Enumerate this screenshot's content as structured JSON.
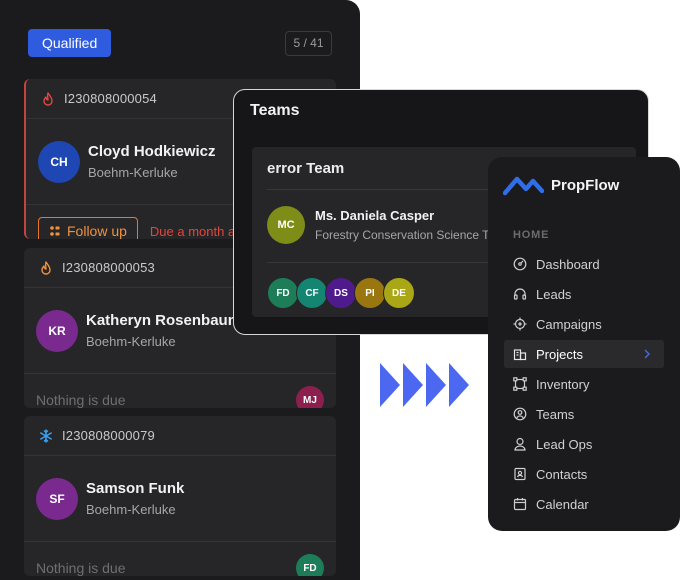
{
  "leads": {
    "status_label": "Qualified",
    "counter": "5 / 41",
    "cards": [
      {
        "id": "I230808000054",
        "priority_icon": "flame-outline-icon",
        "avatar": "CH",
        "avatar_color": "#1e47b3",
        "name": "Cloyd Hodkiewicz",
        "company": "Boehm-Kerluke",
        "action_label": "Follow up",
        "due_text": "Due a month ago"
      },
      {
        "id": "I230808000053",
        "priority_icon": "flame-icon",
        "avatar": "KR",
        "avatar_color": "#7a2a8f",
        "name": "Katheryn Rosenbaum",
        "company": "Boehm-Kerluke",
        "due_text": "Nothing is due",
        "assignee": "MJ",
        "assignee_color": "#8c1f4e"
      },
      {
        "id": "I230808000079",
        "priority_icon": "snowflake-icon",
        "avatar": "SF",
        "avatar_color": "#7a2a8f",
        "name": "Samson Funk",
        "company": "Boehm-Kerluke",
        "due_text": "Nothing is due",
        "assignee": "FD",
        "assignee_color": "#1d7d58"
      }
    ]
  },
  "teams": {
    "title": "Teams",
    "team_name": "error Team",
    "member": {
      "avatar": "MC",
      "avatar_color": "#7d8d17",
      "name": "Ms. Daniela Casper",
      "role": "Forestry Conservation Science Teacher"
    },
    "stack": [
      {
        "initials": "FD",
        "color": "#1d7d58"
      },
      {
        "initials": "CF",
        "color": "#148571"
      },
      {
        "initials": "DS",
        "color": "#4f1a8c"
      },
      {
        "initials": "PI",
        "color": "#9a7611"
      },
      {
        "initials": "DE",
        "color": "#a9a716"
      }
    ]
  },
  "nav": {
    "brand": "PropFlow",
    "section": "HOME",
    "items": [
      {
        "label": "Dashboard",
        "icon": "gauge-icon"
      },
      {
        "label": "Leads",
        "icon": "headset-icon"
      },
      {
        "label": "Campaigns",
        "icon": "target-icon"
      },
      {
        "label": "Projects",
        "icon": "building-icon",
        "active": true
      },
      {
        "label": "Inventory",
        "icon": "box-frame-icon"
      },
      {
        "label": "Teams",
        "icon": "users-circle-icon"
      },
      {
        "label": "Lead Ops",
        "icon": "user-icon"
      },
      {
        "label": "Contacts",
        "icon": "contact-book-icon"
      },
      {
        "label": "Calendar",
        "icon": "calendar-icon"
      }
    ]
  },
  "colors": {
    "accent": "#2f5bde",
    "urgent": "#c2453d",
    "warning": "#f0923d",
    "arrow": "#4d68f0",
    "snowflake": "#3aa0f0"
  }
}
